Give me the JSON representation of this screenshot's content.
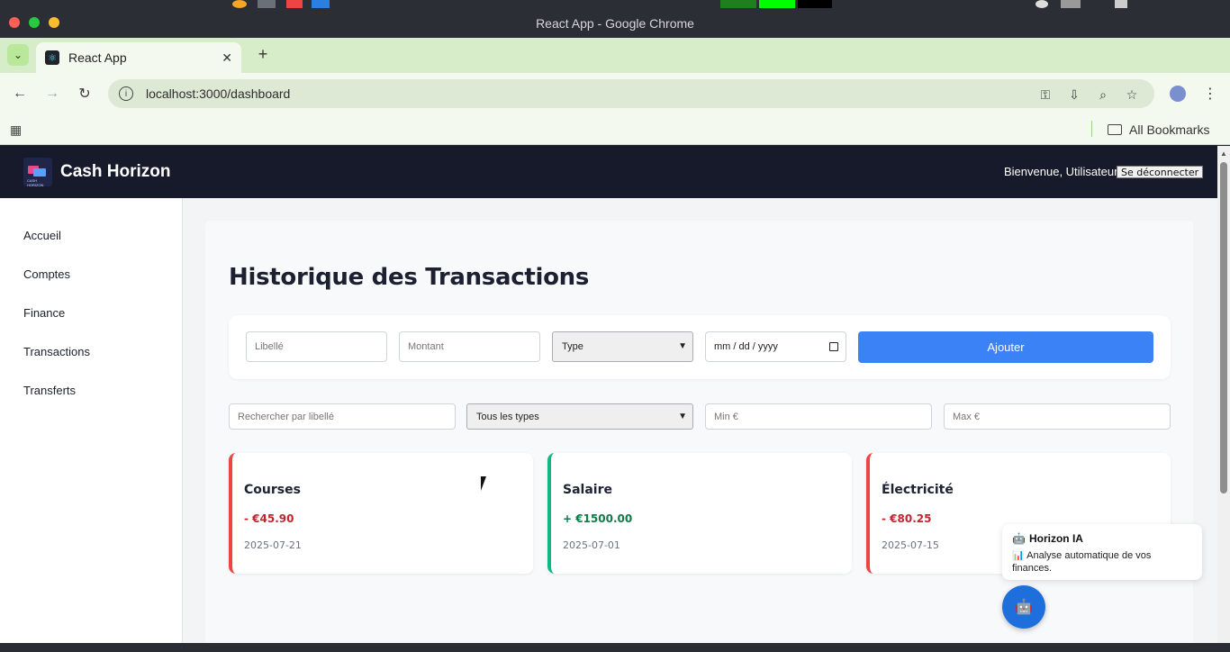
{
  "browser": {
    "window_title": "React App - Google Chrome",
    "tab_title": "React App",
    "url": "localhost:3000/dashboard",
    "bookmarks_label": "All Bookmarks"
  },
  "app": {
    "brand": "Cash Horizon",
    "logo_text": "CASH HORIZON",
    "welcome": "Bienvenue, Utilisateur",
    "logout_label": "Se déconnecter"
  },
  "sidebar": {
    "items": [
      {
        "label": "Accueil"
      },
      {
        "label": "Comptes"
      },
      {
        "label": "Finance"
      },
      {
        "label": "Transactions"
      },
      {
        "label": "Transferts"
      }
    ]
  },
  "main": {
    "title": "Historique des Transactions",
    "form": {
      "label_placeholder": "Libellé",
      "amount_placeholder": "Montant",
      "type_selected": "Type",
      "date_placeholder": "mm / dd / yyyy",
      "add_label": "Ajouter"
    },
    "filters": {
      "search_placeholder": "Rechercher par libellé",
      "type_selected": "Tous les types",
      "min_placeholder": "Min €",
      "max_placeholder": "Max €"
    },
    "transactions": [
      {
        "title": "Courses",
        "amount": "- €45.90",
        "date": "2025-07-21",
        "kind": "expense"
      },
      {
        "title": "Salaire",
        "amount": "+ €1500.00",
        "date": "2025-07-01",
        "kind": "income"
      },
      {
        "title": "Électricité",
        "amount": "- €80.25",
        "date": "2025-07-15",
        "kind": "expense"
      }
    ]
  },
  "assistant": {
    "title": "Horizon IA",
    "message": "Analyse automatique de vos finances."
  },
  "colors": {
    "header_bg": "#171a2b",
    "primary": "#3b82f6",
    "expense": "#ef4444",
    "expense_text": "#c0262d",
    "income": "#10b981",
    "income_text": "#0f7a4a",
    "fab": "#1e6fdc"
  },
  "icons": {
    "back": "arrow-left-icon",
    "forward": "arrow-right-icon",
    "reload": "reload-icon",
    "site_info": "info-icon",
    "password": "key-icon",
    "install": "install-icon",
    "zoom": "zoom-icon",
    "bookmark": "star-icon",
    "menu": "kebab-menu-icon",
    "assistant": "robot-icon",
    "chart": "bar-chart-icon"
  }
}
